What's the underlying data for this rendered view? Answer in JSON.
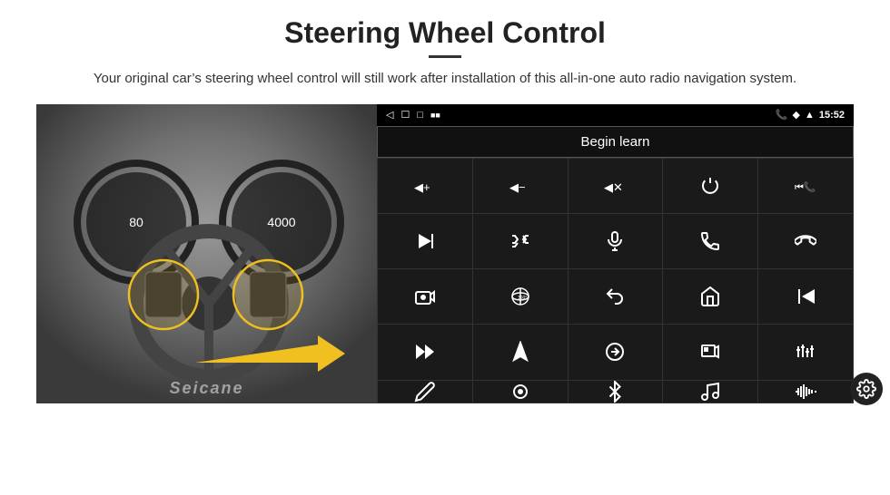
{
  "page": {
    "title": "Steering Wheel Control",
    "subtitle": "Your original car’s steering wheel control will still work after installation of this all-in-one auto radio navigation system."
  },
  "status_bar": {
    "back_icon": "◁",
    "home_icon": "☐",
    "recent_icon": "□",
    "notification_icon": "🔔",
    "phone_icon": "📞",
    "wifi_icon": "▲",
    "signal_icon": "■",
    "time": "15:52"
  },
  "begin_learn": {
    "label": "Begin learn"
  },
  "watermark": "Seicane",
  "buttons": [
    {
      "icon": "vol-up",
      "unicode": "🔊+"
    },
    {
      "icon": "vol-down",
      "unicode": "🔊-"
    },
    {
      "icon": "vol-mute",
      "unicode": "🔇"
    },
    {
      "icon": "power",
      "unicode": "⏻"
    },
    {
      "icon": "prev-track-phone",
      "unicode": "⏮📞"
    },
    {
      "icon": "next-track",
      "unicode": "⏭"
    },
    {
      "icon": "shuffle",
      "unicode": "⇄⏭"
    },
    {
      "icon": "mic",
      "unicode": "🎤"
    },
    {
      "icon": "phone",
      "unicode": "📞"
    },
    {
      "icon": "phone-end",
      "unicode": "↘"
    },
    {
      "icon": "camera",
      "unicode": "📷"
    },
    {
      "icon": "360",
      "unicode": "360"
    },
    {
      "icon": "back",
      "unicode": "↺"
    },
    {
      "icon": "home",
      "unicode": "⌂"
    },
    {
      "icon": "skip-back",
      "unicode": "⏮"
    },
    {
      "icon": "fast-forward",
      "unicode": "⏭⏭"
    },
    {
      "icon": "navigate",
      "unicode": "➤"
    },
    {
      "icon": "eject",
      "unicode": "⇄"
    },
    {
      "icon": "media",
      "unicode": "🎥"
    },
    {
      "icon": "equalizer",
      "unicode": "⫦"
    },
    {
      "icon": "pen",
      "unicode": "✏"
    },
    {
      "icon": "settings-round",
      "unicode": "⊙"
    },
    {
      "icon": "bluetooth",
      "unicode": "⧗"
    },
    {
      "icon": "music",
      "unicode": "♫"
    },
    {
      "icon": "waveform",
      "unicode": "⌇"
    }
  ]
}
